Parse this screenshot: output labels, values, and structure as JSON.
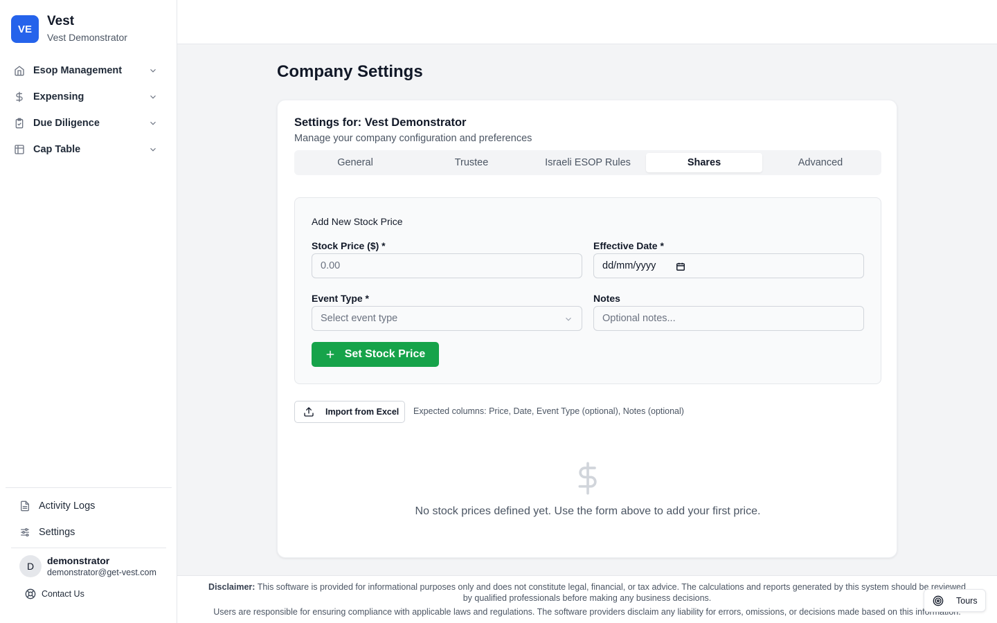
{
  "brand": {
    "logo_text": "VE",
    "name": "Vest",
    "subtitle": "Vest Demonstrator",
    "color": "#2563eb"
  },
  "sidebar": {
    "items": [
      {
        "label": "Esop Management",
        "icon": "home-icon"
      },
      {
        "label": "Expensing",
        "icon": "dollar-icon"
      },
      {
        "label": "Due Diligence",
        "icon": "clipboard-icon"
      },
      {
        "label": "Cap Table",
        "icon": "table-icon"
      }
    ],
    "bottom_items": [
      {
        "label": "Activity Logs",
        "icon": "file-text-icon"
      },
      {
        "label": "Settings",
        "icon": "sliders-icon"
      }
    ],
    "user": {
      "initial": "D",
      "name": "demonstrator",
      "email": "demonstrator@get-vest.com"
    },
    "contact_label": "Contact Us"
  },
  "page": {
    "title": "Company Settings"
  },
  "settings": {
    "title": "Settings for: Vest Demonstrator",
    "description": "Manage your company configuration and preferences",
    "tabs": [
      {
        "label": "General",
        "active": false
      },
      {
        "label": "Trustee",
        "active": false
      },
      {
        "label": "Israeli ESOP Rules",
        "active": false
      },
      {
        "label": "Shares",
        "active": true
      },
      {
        "label": "Advanced",
        "active": false
      }
    ]
  },
  "form": {
    "title": "Add New Stock Price",
    "stock_price": {
      "label": "Stock Price ($) *",
      "placeholder": "0.00",
      "value": ""
    },
    "effective_date": {
      "label": "Effective Date *",
      "placeholder": "dd/mm/yyyy",
      "value": ""
    },
    "event_type": {
      "label": "Event Type *",
      "placeholder": "Select event type",
      "value": ""
    },
    "notes": {
      "label": "Notes",
      "placeholder": "Optional notes...",
      "value": ""
    },
    "submit_label": "Set Stock Price",
    "submit_color": "#16a34a"
  },
  "import": {
    "button_label": "Import from Excel",
    "hint": "Expected columns: Price, Date, Event Type (optional), Notes (optional)"
  },
  "empty_state": {
    "icon": "dollar-icon",
    "text": "No stock prices defined yet. Use the form above to add your first price."
  },
  "footer": {
    "disclaimer_label": "Disclaimer:",
    "disclaimer_text": "This software is provided for informational purposes only and does not constitute legal, financial, or tax advice. The calculations and reports generated by this system should be reviewed by qualified professionals before making any business decisions.",
    "disclaimer_text_2": "Users are responsible for ensuring compliance with applicable laws and regulations. The software providers disclaim any liability for errors, omissions, or decisions made based on this information."
  },
  "tours": {
    "label": "Tours"
  }
}
